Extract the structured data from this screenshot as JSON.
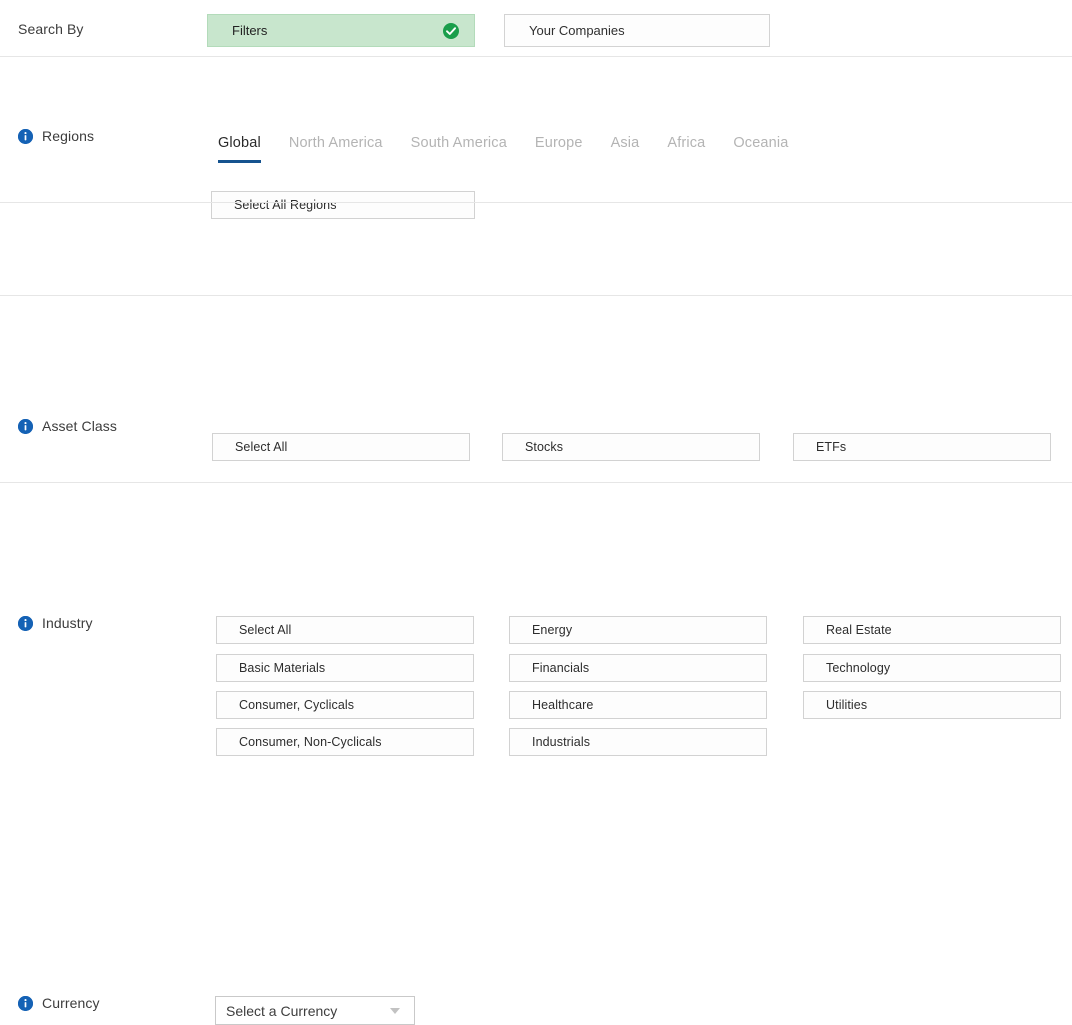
{
  "search_by": {
    "label": "Search By",
    "tabs": [
      {
        "label": "Filters",
        "active": true,
        "icon": "check-circle-icon"
      },
      {
        "label": "Your Companies",
        "active": false
      }
    ]
  },
  "regions": {
    "label": "Regions",
    "info_icon": "info-icon",
    "tabs": [
      {
        "label": "Global",
        "active": true
      },
      {
        "label": "North America",
        "active": false
      },
      {
        "label": "South America",
        "active": false
      },
      {
        "label": "Europe",
        "active": false
      },
      {
        "label": "Asia",
        "active": false
      },
      {
        "label": "Africa",
        "active": false
      },
      {
        "label": "Oceania",
        "active": false
      }
    ],
    "options": [
      {
        "label": "Select All Regions"
      }
    ]
  },
  "asset_class": {
    "label": "Asset Class",
    "info_icon": "info-icon",
    "options": [
      {
        "label": "Select All"
      },
      {
        "label": "Stocks"
      },
      {
        "label": "ETFs"
      }
    ]
  },
  "industry": {
    "label": "Industry",
    "info_icon": "info-icon",
    "columns": [
      [
        {
          "label": "Select All"
        },
        {
          "label": "Basic Materials"
        },
        {
          "label": "Consumer, Cyclicals"
        },
        {
          "label": "Consumer, Non-Cyclicals"
        }
      ],
      [
        {
          "label": "Energy"
        },
        {
          "label": "Financials"
        },
        {
          "label": "Healthcare"
        },
        {
          "label": "Industrials"
        }
      ],
      [
        {
          "label": "Real Estate"
        },
        {
          "label": "Technology"
        },
        {
          "label": "Utilities"
        }
      ]
    ]
  },
  "currency": {
    "label": "Currency",
    "info_icon": "info-icon",
    "select": {
      "value": "Select a Currency",
      "caret_icon": "chevron-down-icon"
    }
  },
  "colors": {
    "accent_blue": "#15538f",
    "info_blue": "#1562b5",
    "active_green_bg": "#c8e6cd",
    "check_green": "#1a9e4b",
    "border_gray": "#d2d2d2",
    "divider_gray": "#e6e6e6"
  }
}
